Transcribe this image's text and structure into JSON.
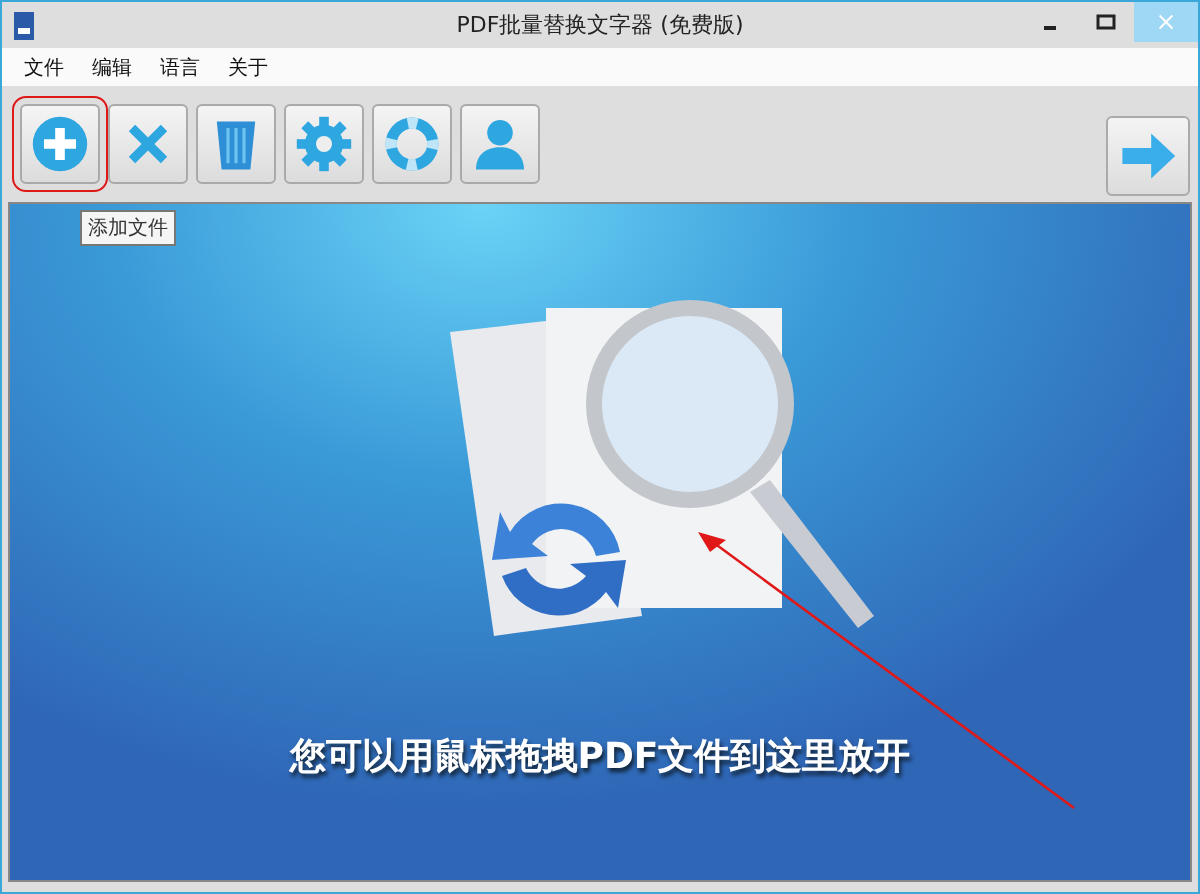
{
  "window": {
    "title": "PDF批量替换文字器 (免费版)"
  },
  "menu": [
    {
      "label": "文件"
    },
    {
      "label": "编辑"
    },
    {
      "label": "语言"
    },
    {
      "label": "关于"
    }
  ],
  "toolbar": [
    {
      "kind": "add",
      "highlighted": true
    },
    {
      "kind": "remove",
      "highlighted": false
    },
    {
      "kind": "clear",
      "highlighted": false
    },
    {
      "kind": "settings",
      "highlighted": false
    },
    {
      "kind": "help",
      "highlighted": false
    },
    {
      "kind": "user",
      "highlighted": false
    }
  ],
  "next_button": {
    "kind": "next"
  },
  "tooltip": "添加文件",
  "drop_hint": "您可以用鼠标拖拽PDF文件到这里放开"
}
